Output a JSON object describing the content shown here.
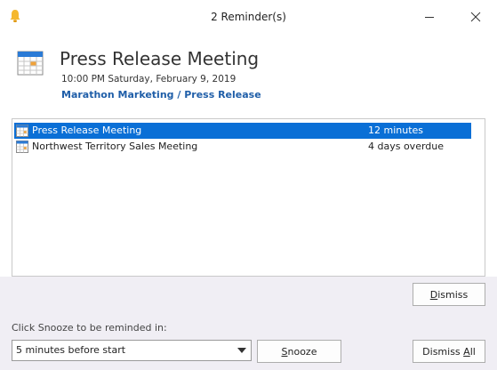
{
  "window": {
    "title": "2 Reminder(s)"
  },
  "header": {
    "title": "Press Release Meeting",
    "time": "10:00 PM Saturday, February 9, 2019",
    "location": "Marathon Marketing / Press Release"
  },
  "reminders": [
    {
      "subject": "Press Release Meeting",
      "due": "12 minutes",
      "selected": true
    },
    {
      "subject": "Northwest Territory Sales Meeting",
      "due": "4 days overdue",
      "selected": false
    }
  ],
  "buttons": {
    "dismiss": {
      "prefix": "",
      "mnemonic": "D",
      "rest": "ismiss"
    },
    "snooze": {
      "prefix": "",
      "mnemonic": "S",
      "rest": "nooze"
    },
    "dismiss_all": {
      "prefix": "Dismiss ",
      "mnemonic": "A",
      "rest": "ll"
    }
  },
  "snooze": {
    "label": "Click Snooze to be reminded in:",
    "selected_value": "5 minutes before start"
  },
  "colors": {
    "selection": "#0a6fd6",
    "link": "#1f5ea8",
    "bell": "#f5b82e",
    "calendar_header": "#2b7bd6"
  },
  "icons": {
    "bell": "bell-icon",
    "calendar": "calendar-icon",
    "minimize": "minimize-icon",
    "close": "close-icon",
    "dropdown": "chevron-down-icon"
  }
}
